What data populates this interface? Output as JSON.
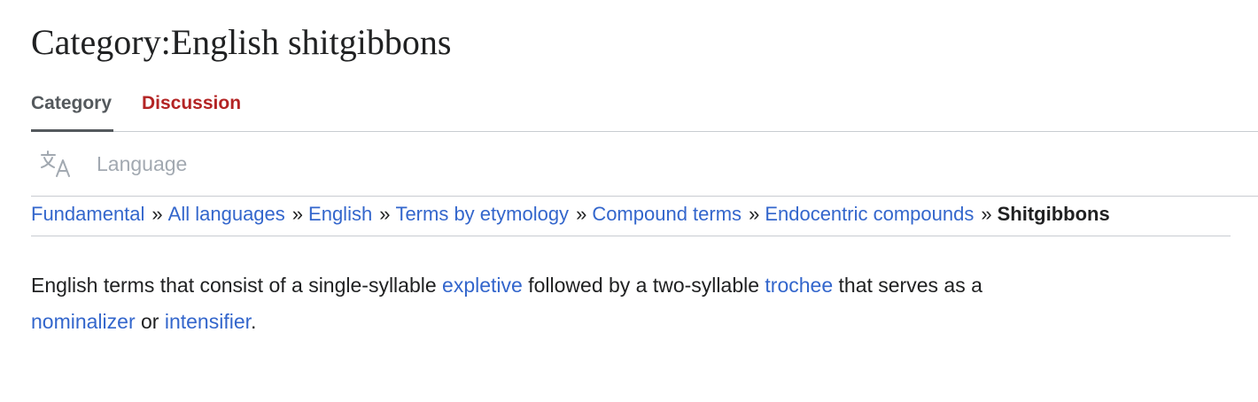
{
  "page": {
    "title": "Category:English shitgibbons"
  },
  "tabs": [
    {
      "label": "Category",
      "active": true
    },
    {
      "label": "Discussion",
      "active": false
    }
  ],
  "language": {
    "icon": "translate-icon",
    "label": "Language"
  },
  "breadcrumb": {
    "items": [
      "Fundamental",
      "All languages",
      "English",
      "Terms by etymology",
      "Compound terms",
      "Endocentric compounds"
    ],
    "separator": "»",
    "current": "Shitgibbons"
  },
  "description": {
    "text_1": "English terms that consist of a single-syllable ",
    "link_1": "expletive",
    "text_2": " followed by a two-syllable ",
    "link_2": "trochee",
    "text_3": " that serves as a ",
    "link_3": "nominalizer",
    "text_4": " or ",
    "link_4": "intensifier",
    "text_5": "."
  },
  "colors": {
    "link": "#3366cc",
    "missing_link": "#b32424",
    "text": "#202122",
    "muted": "#a2a9b1",
    "border": "#c8ccd1"
  }
}
